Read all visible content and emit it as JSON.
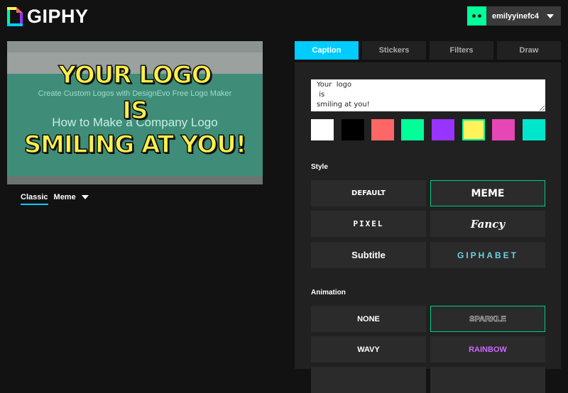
{
  "header": {
    "brand": "GIPHY",
    "username": "emilyyinefc4",
    "avatar_color": "#00ff99"
  },
  "preview": {
    "caption_lines": [
      "YOUR  LOGO",
      "IS",
      "SMILING AT YOU!"
    ],
    "background_text": [
      "Create Custom Logos with DesignEvo Free Logo Maker",
      "How to Make a Company Logo"
    ],
    "modes": [
      {
        "label": "Classic",
        "active": true
      },
      {
        "label": "Meme"
      }
    ]
  },
  "tabs": [
    {
      "label": "Caption",
      "active": true
    },
    {
      "label": "Stickers"
    },
    {
      "label": "Filters"
    },
    {
      "label": "Draw"
    }
  ],
  "caption": {
    "text": "Your  logo\n is\nsmiling at you!"
  },
  "swatches": [
    {
      "color": "#ffffff"
    },
    {
      "color": "#000000"
    },
    {
      "color": "#ff6666"
    },
    {
      "color": "#00ff99"
    },
    {
      "color": "#9933ff"
    },
    {
      "color": "#fff35c",
      "selected": true
    },
    {
      "color": "#e646b6"
    },
    {
      "color": "#00e6cc"
    }
  ],
  "style": {
    "label": "Style",
    "options": [
      "DEFAULT",
      "MEME",
      "PIXEL",
      "Fancy",
      "Subtitle",
      "GIPHABET"
    ],
    "selected": "MEME"
  },
  "animation": {
    "label": "Animation",
    "options": [
      "NONE",
      "SPARKLE",
      "WAVY",
      "RAINBOW"
    ],
    "selected": "SPARKLE"
  },
  "colors": {
    "accent": "#00ccff",
    "selection": "#00cc80"
  }
}
